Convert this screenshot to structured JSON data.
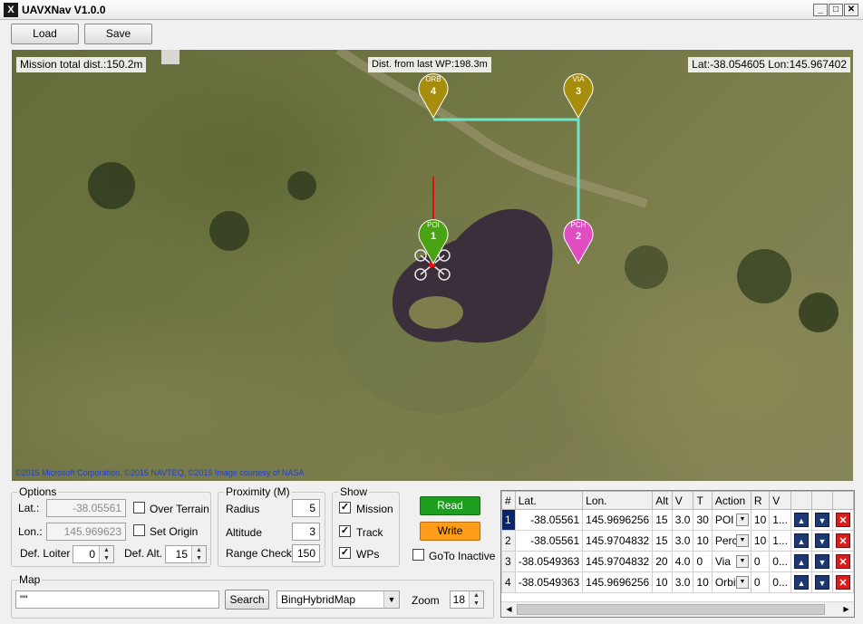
{
  "window": {
    "title": "UAVXNav  V1.0.0"
  },
  "toolbar": {
    "load_label": "Load",
    "save_label": "Save"
  },
  "map": {
    "mission_total": "Mission total dist.:150.2m",
    "dist_from_last": "Dist. from last WP:198.3m",
    "coords": "Lat:-38.054605 Lon:145.967402",
    "copyright": "©2015 Microsoft Corporation, ©2015 NAVTEQ, ©2015 Image courtesy of NASA",
    "markers": [
      {
        "num": "1",
        "code": "POI",
        "color": "#49a312"
      },
      {
        "num": "2",
        "code": "PCH",
        "color": "#e04dc0"
      },
      {
        "num": "3",
        "code": "VIA",
        "color": "#a68e0c"
      },
      {
        "num": "4",
        "code": "ORB",
        "color": "#a68e0c"
      }
    ],
    "route_color": "#6fe6c8",
    "heading_color": "#e01010"
  },
  "options": {
    "title": "Options",
    "lat_label": "Lat.:",
    "lat_value": "-38.05561",
    "lon_label": "Lon.:",
    "lon_value": "145.969623",
    "over_terrain": "Over Terrain",
    "set_origin": "Set Origin",
    "def_loiter_label": "Def. Loiter",
    "def_loiter_value": "0",
    "def_alt_label": "Def. Alt.",
    "def_alt_value": "15"
  },
  "proximity": {
    "title": "Proximity (M)",
    "radius_label": "Radius",
    "radius_value": "5",
    "altitude_label": "Altitude",
    "altitude_value": "3",
    "range_label": "Range Check",
    "range_value": "150"
  },
  "show": {
    "title": "Show",
    "mission": "Mission",
    "track": "Track",
    "wps": "WPs"
  },
  "actions": {
    "read_label": "Read",
    "read_color": "#1e9e1e",
    "write_label": "Write",
    "write_color": "#ff9d1a",
    "goto_inactive": "GoTo Inactive"
  },
  "mapbox": {
    "title": "Map",
    "search_value": "\"\"",
    "search_button": "Search",
    "map_type": "BingHybridMap",
    "zoom_label": "Zoom",
    "zoom_value": "18"
  },
  "grid": {
    "headers": [
      "#",
      "Lat.",
      "Lon.",
      "Alt",
      "V",
      "T",
      "Action",
      "R",
      "V"
    ],
    "rows": [
      {
        "n": "1",
        "lat": "-38.05561",
        "lon": "145.9696256",
        "alt": "15",
        "v": "3.0",
        "t": "30",
        "action": "POI",
        "r": "10",
        "v2": "1..."
      },
      {
        "n": "2",
        "lat": "-38.05561",
        "lon": "145.9704832",
        "alt": "15",
        "v": "3.0",
        "t": "10",
        "action": "Perch",
        "r": "10",
        "v2": "1..."
      },
      {
        "n": "3",
        "lat": "-38.0549363",
        "lon": "145.9704832",
        "alt": "20",
        "v": "4.0",
        "t": "0",
        "action": "Via",
        "r": "0",
        "v2": "0..."
      },
      {
        "n": "4",
        "lat": "-38.0549363",
        "lon": "145.9696256",
        "alt": "10",
        "v": "3.0",
        "t": "10",
        "action": "Orbit",
        "r": "0",
        "v2": "0..."
      }
    ]
  }
}
